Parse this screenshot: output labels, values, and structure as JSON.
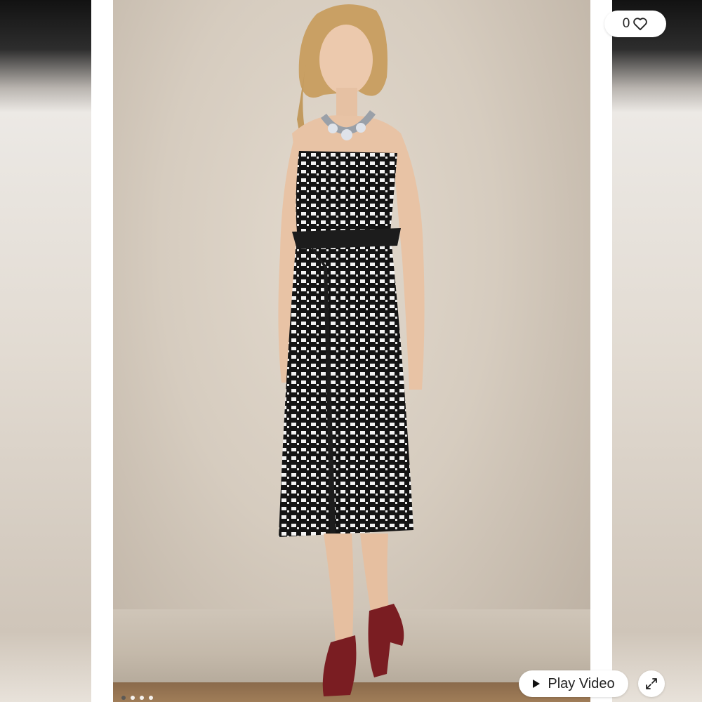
{
  "gallery": {
    "likes": {
      "count": "0",
      "icon": "heart-icon"
    },
    "play_video": {
      "label": "Play Video",
      "icon": "play-icon"
    },
    "expand": {
      "icon": "expand-icon"
    },
    "pagination": {
      "total": 4,
      "active_index": 0
    }
  },
  "colors": {
    "pill_background": "#ffffff",
    "pill_text": "#222222",
    "frame": "#ffffff"
  }
}
